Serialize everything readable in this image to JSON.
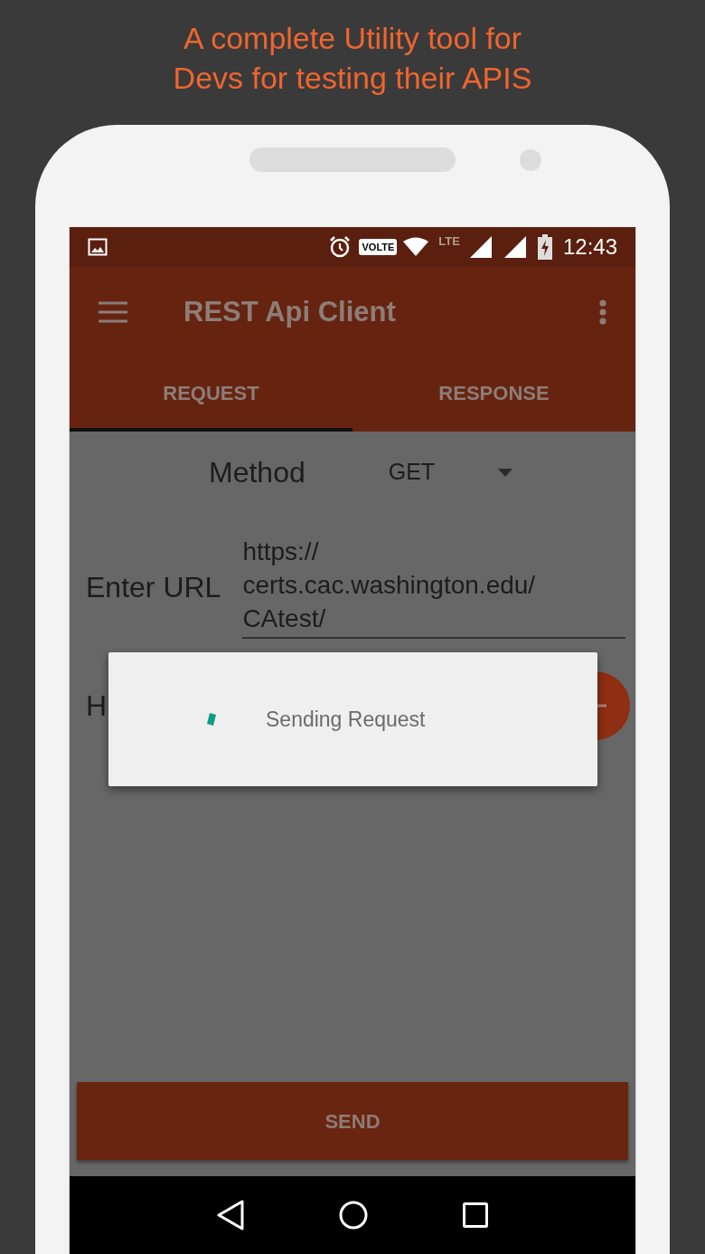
{
  "headline": "A complete Utility tool for\nDevs for testing their APIS",
  "status_bar": {
    "volte": "VOLTE",
    "network": "LTE",
    "time": "12:43"
  },
  "app_bar": {
    "title": "REST Api Client"
  },
  "tabs": [
    {
      "label": "REQUEST",
      "selected": true
    },
    {
      "label": "RESPONSE",
      "selected": false
    }
  ],
  "form": {
    "method_label": "Method",
    "method_value": "GET",
    "url_label": "Enter URL",
    "url_value": "https://\ncerts.cac.washington.edu/\nCAtest/",
    "headers_label": "H"
  },
  "send_button": "SEND",
  "dialog": {
    "message": "Sending Request"
  }
}
